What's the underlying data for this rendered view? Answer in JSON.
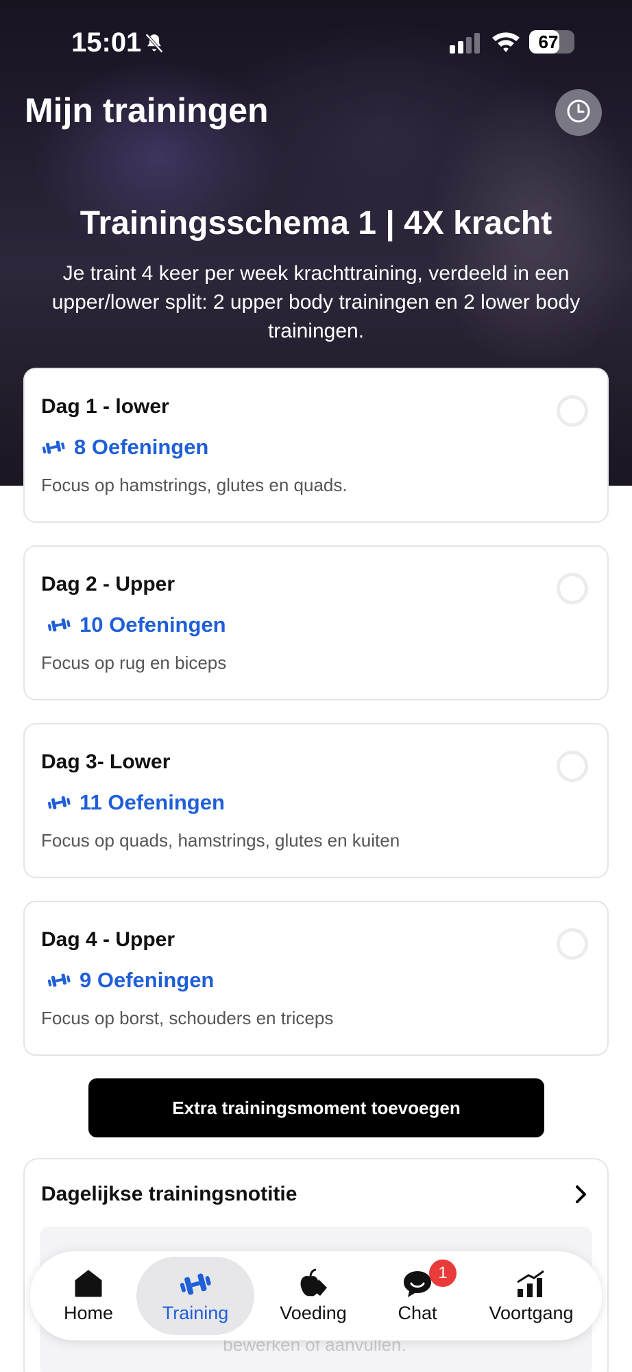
{
  "status_bar": {
    "time": "15:01",
    "battery": "67",
    "battery_level": 0.67
  },
  "header": {
    "title": "Mijn trainingen"
  },
  "plan": {
    "title": "Trainingsschema 1 |  4X kracht",
    "description": "Je traint 4 keer per week krachttraining, verdeeld in een upper/lower split: 2 upper body trainingen en 2 lower body trainingen."
  },
  "days": [
    {
      "title": "Dag 1 - lower",
      "count": "8 Oefeningen",
      "description": "Focus op hamstrings, glutes en quads."
    },
    {
      "title": "Dag 2 - Upper",
      "count": "10 Oefeningen",
      "description": "Focus op rug en biceps"
    },
    {
      "title": "Dag 3- Lower",
      "count": "11 Oefeningen",
      "description": "Focus op quads, hamstrings, glutes en kuiten"
    },
    {
      "title": "Dag 4 - Upper",
      "count": "9 Oefeningen",
      "description": "Focus op borst, schouders en triceps"
    }
  ],
  "add_button": {
    "label": "Extra trainingsmoment toevoegen"
  },
  "note": {
    "title": "Dagelijkse trainingsnotitie",
    "text": "bewerken of aanvullen."
  },
  "nav": {
    "items": [
      {
        "label": "Home",
        "icon": "home-icon"
      },
      {
        "label": "Training",
        "icon": "dumbbell-icon",
        "active": true
      },
      {
        "label": "Voeding",
        "icon": "apple-carrot-icon"
      },
      {
        "label": "Chat",
        "icon": "chat-icon",
        "badge": "1"
      },
      {
        "label": "Voortgang",
        "icon": "progress-chart-icon"
      }
    ]
  },
  "colors": {
    "accent": "#1f5fd8",
    "badge": "#ea3b3b",
    "button": "#000000"
  }
}
